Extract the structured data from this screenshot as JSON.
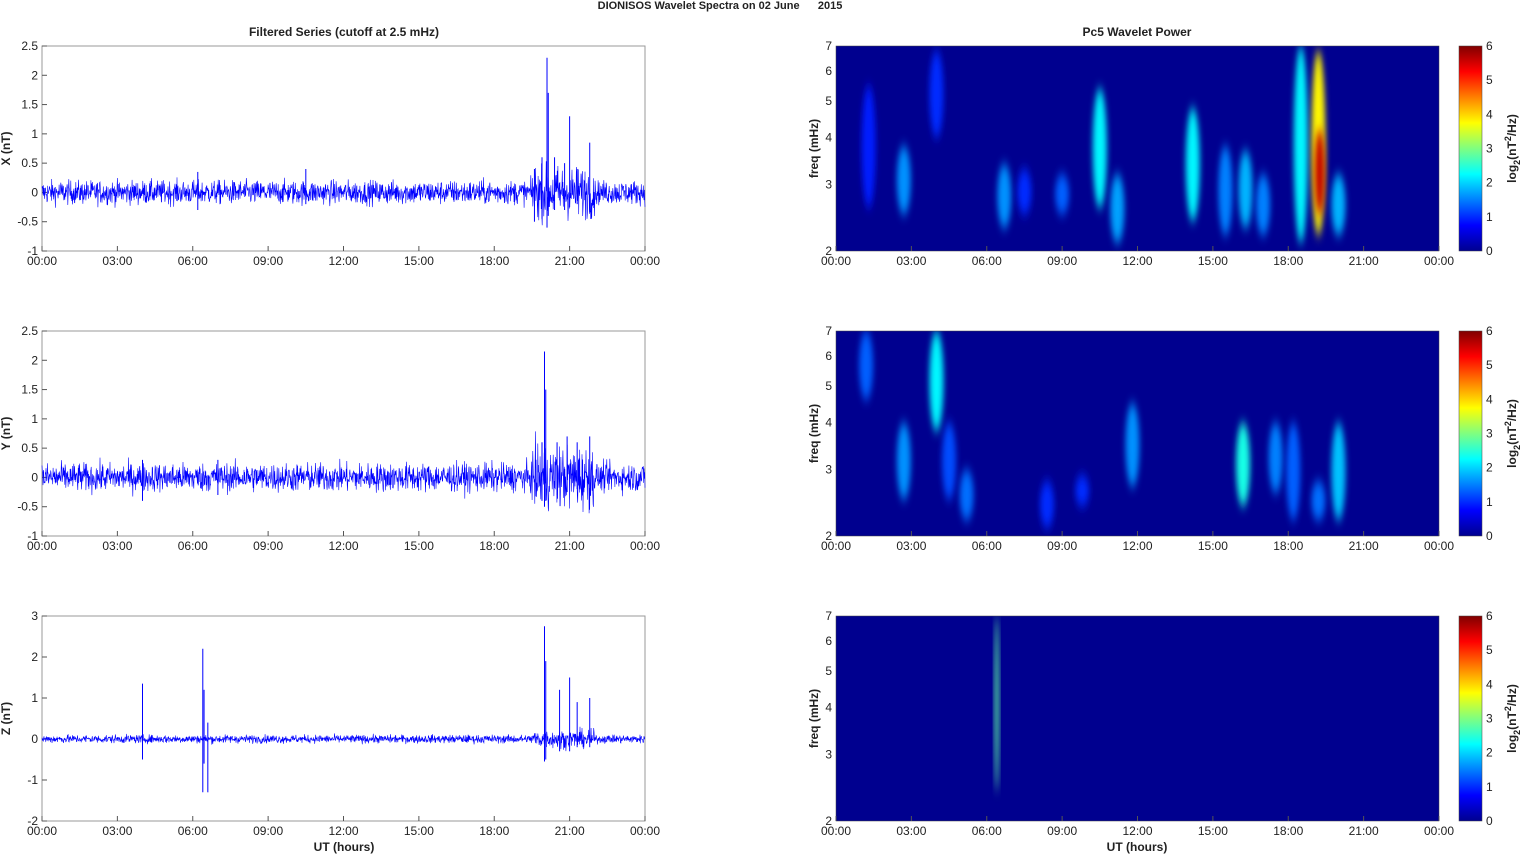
{
  "title": "DIONISOS Wavelet Spectra on 02 June      2015",
  "chart_data": {
    "type": "line",
    "xlabel": "UT (hours)",
    "xticks": [
      "00:00",
      "03:00",
      "06:00",
      "09:00",
      "12:00",
      "15:00",
      "18:00",
      "21:00",
      "00:00"
    ],
    "xlim_hours": [
      0,
      24
    ],
    "left_title": "Filtered Series (cutoff at 2.5 mHz)",
    "right_title": "Pc5 Wavelet Power",
    "colorbar": {
      "label": "log2(nT²/Hz)",
      "range": [
        0,
        6
      ],
      "ticks": [
        "0",
        "1",
        "2",
        "3",
        "4",
        "5",
        "6"
      ],
      "colormap": "jet"
    },
    "series_color": "#0000ff",
    "time_series": [
      {
        "name": "X",
        "ylabel": "X (nT)",
        "ylim": [
          -1,
          2.5
        ],
        "yticks": [
          "-1",
          "-0.5",
          "0",
          "0.5",
          "1",
          "1.5",
          "2",
          "2.5"
        ],
        "yvals": [
          -1,
          -0.5,
          0,
          0.5,
          1,
          1.5,
          2,
          2.5
        ],
        "noise": 0.1,
        "spikes": [
          [
            19.6,
            0.4,
            -0.5
          ],
          [
            19.9,
            0.6,
            -0.45
          ],
          [
            20.1,
            2.3,
            -0.6
          ],
          [
            20.15,
            1.7,
            -0.4
          ],
          [
            20.4,
            0.6,
            -0.3
          ],
          [
            20.8,
            0.5,
            -0.3
          ],
          [
            21.0,
            1.3,
            -0.25
          ],
          [
            21.3,
            0.4,
            -0.2
          ],
          [
            21.8,
            0.85,
            -0.2
          ],
          [
            10.5,
            0.4,
            -0.2
          ],
          [
            6.2,
            0.35,
            -0.3
          ]
        ]
      },
      {
        "name": "Y",
        "ylabel": "Y (nT)",
        "ylim": [
          -1,
          2.5
        ],
        "yticks": [
          "-1",
          "-0.5",
          "0",
          "0.5",
          "1",
          "1.5",
          "2",
          "2.5"
        ],
        "yvals": [
          -1,
          -0.5,
          0,
          0.5,
          1,
          1.5,
          2,
          2.5
        ],
        "noise": 0.12,
        "spikes": [
          [
            19.9,
            0.6,
            -0.4
          ],
          [
            20.0,
            2.15,
            -0.5
          ],
          [
            20.05,
            1.5,
            -0.4
          ],
          [
            20.5,
            0.6,
            -0.3
          ],
          [
            20.9,
            0.7,
            -0.25
          ],
          [
            21.3,
            0.6,
            -0.2
          ],
          [
            21.8,
            0.7,
            -0.2
          ],
          [
            4.0,
            0.3,
            -0.4
          ],
          [
            7.0,
            0.3,
            -0.3
          ]
        ]
      },
      {
        "name": "Z",
        "ylabel": "Z (nT)",
        "ylim": [
          -2,
          3
        ],
        "yticks": [
          "-2",
          "-1",
          "0",
          "1",
          "2",
          "3"
        ],
        "yvals": [
          -2,
          -1,
          0,
          1,
          2,
          3
        ],
        "noise": 0.05,
        "spikes": [
          [
            4.0,
            1.35,
            -0.5
          ],
          [
            6.4,
            2.2,
            -1.3
          ],
          [
            6.6,
            0.4,
            -1.3
          ],
          [
            6.45,
            1.2,
            -0.6
          ],
          [
            20.0,
            2.75,
            -0.55
          ],
          [
            20.05,
            1.9,
            -0.5
          ],
          [
            20.6,
            1.2,
            -0.3
          ],
          [
            21.0,
            1.5,
            -0.3
          ],
          [
            21.3,
            0.9,
            -0.2
          ],
          [
            21.8,
            1.0,
            -0.2
          ]
        ]
      }
    ],
    "spectrograms": [
      {
        "name": "X",
        "ylabel": "freq (mHz)",
        "ylim": [
          2,
          7
        ],
        "yticks": [
          "2",
          "3",
          "4",
          "5",
          "6",
          "7"
        ],
        "yvals": [
          2,
          3,
          4,
          5,
          6,
          7
        ],
        "features": [
          [
            1.3,
            2.6,
            5.5,
            0.9
          ],
          [
            2.7,
            2.5,
            3.8,
            1.6
          ],
          [
            4.0,
            4.0,
            6.8,
            1.0
          ],
          [
            6.7,
            2.3,
            3.4,
            1.6
          ],
          [
            7.5,
            2.5,
            3.3,
            1.0
          ],
          [
            9.0,
            2.5,
            3.2,
            1.3
          ],
          [
            10.5,
            2.6,
            5.4,
            2.2
          ],
          [
            11.2,
            2.1,
            3.2,
            1.7
          ],
          [
            14.2,
            2.4,
            4.8,
            2.2
          ],
          [
            15.5,
            2.2,
            3.8,
            1.5
          ],
          [
            16.3,
            2.3,
            3.7,
            1.8
          ],
          [
            17.0,
            2.2,
            3.2,
            1.5
          ],
          [
            18.5,
            2.1,
            7.0,
            2.2
          ],
          [
            19.2,
            2.2,
            6.8,
            3.8
          ],
          [
            19.25,
            2.5,
            4.2,
            5.6
          ],
          [
            20.0,
            2.2,
            3.2,
            1.8
          ]
        ]
      },
      {
        "name": "Y",
        "ylabel": "freq (mHz)",
        "ylim": [
          2,
          7
        ],
        "yticks": [
          "2",
          "3",
          "4",
          "5",
          "6",
          "7"
        ],
        "yvals": [
          2,
          3,
          4,
          5,
          6,
          7
        ],
        "features": [
          [
            1.2,
            4.6,
            7.0,
            1.3
          ],
          [
            2.7,
            2.5,
            4.0,
            1.6
          ],
          [
            4.0,
            3.8,
            7.0,
            2.2
          ],
          [
            4.5,
            2.5,
            4.0,
            1.2
          ],
          [
            5.2,
            2.2,
            3.0,
            1.4
          ],
          [
            8.4,
            2.1,
            2.8,
            1.0
          ],
          [
            9.8,
            2.4,
            2.9,
            1.0
          ],
          [
            11.8,
            2.7,
            4.5,
            1.6
          ],
          [
            16.2,
            2.4,
            4.0,
            2.4
          ],
          [
            17.5,
            2.6,
            4.0,
            1.5
          ],
          [
            18.2,
            2.2,
            4.0,
            1.3
          ],
          [
            19.2,
            2.2,
            2.8,
            1.4
          ],
          [
            20.0,
            2.2,
            4.0,
            1.9
          ]
        ]
      },
      {
        "name": "Z",
        "ylabel": "freq (mHz)",
        "ylim": [
          2,
          7
        ],
        "yticks": [
          "2",
          "3",
          "4",
          "5",
          "6",
          "7"
        ],
        "yvals": [
          2,
          3,
          4,
          5,
          6,
          7
        ],
        "features": [
          [
            6.4,
            2.4,
            7.0,
            2.8
          ]
        ]
      }
    ]
  }
}
